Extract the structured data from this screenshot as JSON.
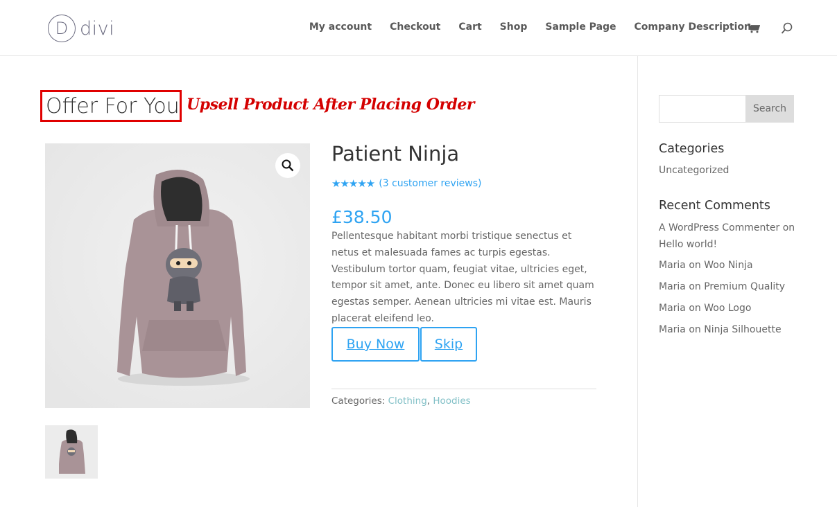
{
  "header": {
    "logo_letter": "D",
    "logo_text": "divi",
    "nav": [
      "My account",
      "Checkout",
      "Cart",
      "Shop",
      "Sample Page",
      "Company Description"
    ]
  },
  "offer": {
    "title": "Offer For You",
    "annotation": "Upsell Product After Placing Order",
    "annotation_color": "#e00000"
  },
  "product": {
    "title": "Patient Ninja",
    "rating": 5,
    "stars": "★★★★★",
    "reviews_link": "(3 customer reviews)",
    "price": "£38.50",
    "description": "Pellentesque habitant morbi tristique senectus et netus et malesuada fames ac turpis egestas. Vestibulum tortor quam, feugiat vitae, ultricies eget, tempor sit amet, ante. Donec eu libero sit amet quam egestas semper. Aenean ultricies mi vitae est. Mauris placerat eleifend leo.",
    "buy_label": "Buy Now",
    "skip_label": "Skip",
    "categories_label": "Categories:",
    "categories": [
      "Clothing",
      "Hoodies"
    ],
    "separator": ", "
  },
  "sidebar": {
    "search_button": "Search",
    "search_placeholder": "",
    "categories_title": "Categories",
    "categories": [
      "Uncategorized"
    ],
    "recent_comments_title": "Recent Comments",
    "comments": [
      {
        "author": "A WordPress Commenter",
        "on": " on ",
        "post": "Hello world!"
      },
      {
        "author": "Maria",
        "on": " on ",
        "post": "Woo Ninja"
      },
      {
        "author": "Maria",
        "on": " on ",
        "post": "Premium Quality"
      },
      {
        "author": "Maria",
        "on": " on ",
        "post": "Woo Logo"
      },
      {
        "author": "Maria",
        "on": " on ",
        "post": "Ninja Silhouette"
      }
    ]
  },
  "colors": {
    "accent": "#2ea3f2",
    "category_link": "#82c0c7"
  },
  "icons": {
    "cart": "cart-icon",
    "search": "search-icon",
    "zoom": "magnifier-icon"
  }
}
